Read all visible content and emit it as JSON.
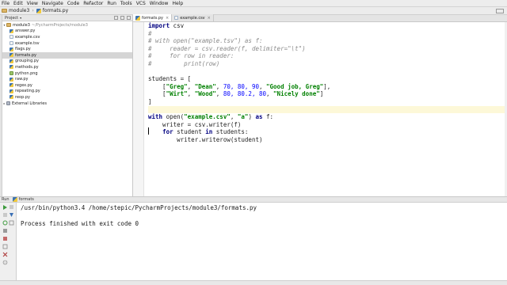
{
  "menu": [
    "File",
    "Edit",
    "View",
    "Navigate",
    "Code",
    "Refactor",
    "Run",
    "Tools",
    "VCS",
    "Window",
    "Help"
  ],
  "breadcrumbs": [
    "module3",
    "formats.py"
  ],
  "project_panel": {
    "title": "Project",
    "root_label": "module3",
    "root_path": "~/PycharmProjects/module3",
    "files": [
      "answer.py",
      "example.csv",
      "example.tsv",
      "flags.py",
      "formats.py",
      "grouping.py",
      "methods.py",
      "python.png",
      "raw.py",
      "regex.py",
      "repeating.py",
      "reop.py"
    ],
    "selected": "formats.py",
    "external": "External Libraries"
  },
  "tabs": [
    {
      "label": "formats.py",
      "active": true
    },
    {
      "label": "example.csv",
      "active": false
    }
  ],
  "code": {
    "l1_kw": "import",
    "l1_rest": " csv",
    "l2": "#",
    "l3": "# with open(\"example.tsv\") as f:",
    "l4": "#     reader = csv.reader(f, delimiter=\"\\t\")",
    "l5": "#     for row in reader:",
    "l6": "#         print(row)",
    "l7": "",
    "l8": "students = [",
    "l9_a": "    [",
    "l9_s1": "\"Greg\"",
    "l9_c1": ", ",
    "l9_s2": "\"Dean\"",
    "l9_c2": ", ",
    "l9_n": "70, 80, 90",
    "l9_c3": ", ",
    "l9_s3": "\"Good job, Greg\"",
    "l9_b": "],",
    "l10_a": "    [",
    "l10_s1": "\"Wirt\"",
    "l10_c1": ", ",
    "l10_s2": "\"Wood\"",
    "l10_c2": ", ",
    "l10_n": "80, 80.2, 80",
    "l10_c3": ", ",
    "l10_s3": "\"Nicely done\"",
    "l10_b": "]",
    "l11": "]",
    "l12": "",
    "l13_kw": "with",
    "l13_a": " open(",
    "l13_s1": "\"example.csv\"",
    "l13_b": ", ",
    "l13_s2": "\"a\"",
    "l13_c": ") ",
    "l13_kw2": "as",
    "l13_d": " f:",
    "l14": "    writer = csv.writer(f)",
    "l15_a": "    ",
    "l15_kw": "for",
    "l15_b": " student ",
    "l15_kw2": "in",
    "l15_c": " students:",
    "l16": "        writer.writerow(student)"
  },
  "run_panel": {
    "label": "Run",
    "config": "formats",
    "command": "/usr/bin/python3.4 /home/stepic/PycharmProjects/module3/formats.py",
    "output": "Process finished with exit code 0"
  },
  "colors": {
    "keyword": "#000080",
    "string": "#008000",
    "number": "#0000ff",
    "comment": "#8a8a8a",
    "current_line": "#fdf8d8"
  }
}
